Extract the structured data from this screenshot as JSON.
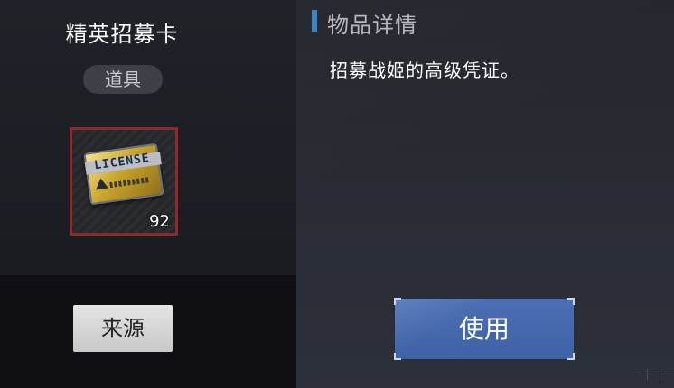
{
  "item": {
    "name": "精英招募卡",
    "category": "道具",
    "count": "92",
    "icon": "license-card-icon",
    "icon_text": "LICENSE"
  },
  "buttons": {
    "source_label": "来源",
    "use_label": "使用"
  },
  "details": {
    "section_title": "物品详情",
    "description": "招募战姬的高级凭证。"
  },
  "colors": {
    "accent_blue": "#3a84c8",
    "use_button": "#4468ad",
    "item_border": "#8f2a2a"
  }
}
